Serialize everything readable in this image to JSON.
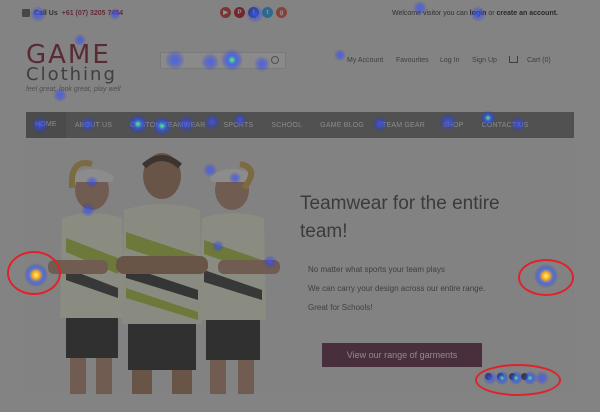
{
  "topbar": {
    "call_label": "Call Us",
    "phone": "+61 (07) 3205 7454",
    "welcome_prefix": "Welcome visitor you can",
    "login": "login",
    "or": "or",
    "create": "create an account."
  },
  "socials": [
    {
      "icon": "youtube-icon",
      "glyph": "▶",
      "color": "#c4302b"
    },
    {
      "icon": "pinterest-icon",
      "glyph": "P",
      "color": "#bd081c"
    },
    {
      "icon": "facebook-icon",
      "glyph": "f",
      "color": "#3b5998"
    },
    {
      "icon": "twitter-icon",
      "glyph": "t",
      "color": "#1da1f2"
    },
    {
      "icon": "googleplus-icon",
      "glyph": "g",
      "color": "#dd4b39"
    }
  ],
  "logo": {
    "line1": "GAME",
    "line2": "Clothing",
    "tagline": "feel great, look great, play well"
  },
  "search": {
    "placeholder": ""
  },
  "account_links": {
    "my_account": "My Account",
    "favourites": "Favourites",
    "login": "Log In",
    "signup": "Sign Up",
    "cart": "Cart (0)"
  },
  "nav": [
    "HOME",
    "ABOUT US",
    "CUSTOM TEAMWEAR",
    "SPORTS",
    "SCHOOL",
    "GAME BLOG",
    "TEAM GEAR",
    "SHOP",
    "CONTACT US"
  ],
  "hero": {
    "heading": "Teamwear for the entire team!",
    "lines": [
      "No matter what sports your team plays",
      "We can carry your design across our entire range.",
      "Great for Schools!"
    ],
    "button": "View our range of garments",
    "slides": 4
  },
  "colors": {
    "brand": "#7a1428",
    "button": "#58213a",
    "ring": "#e0222a"
  }
}
